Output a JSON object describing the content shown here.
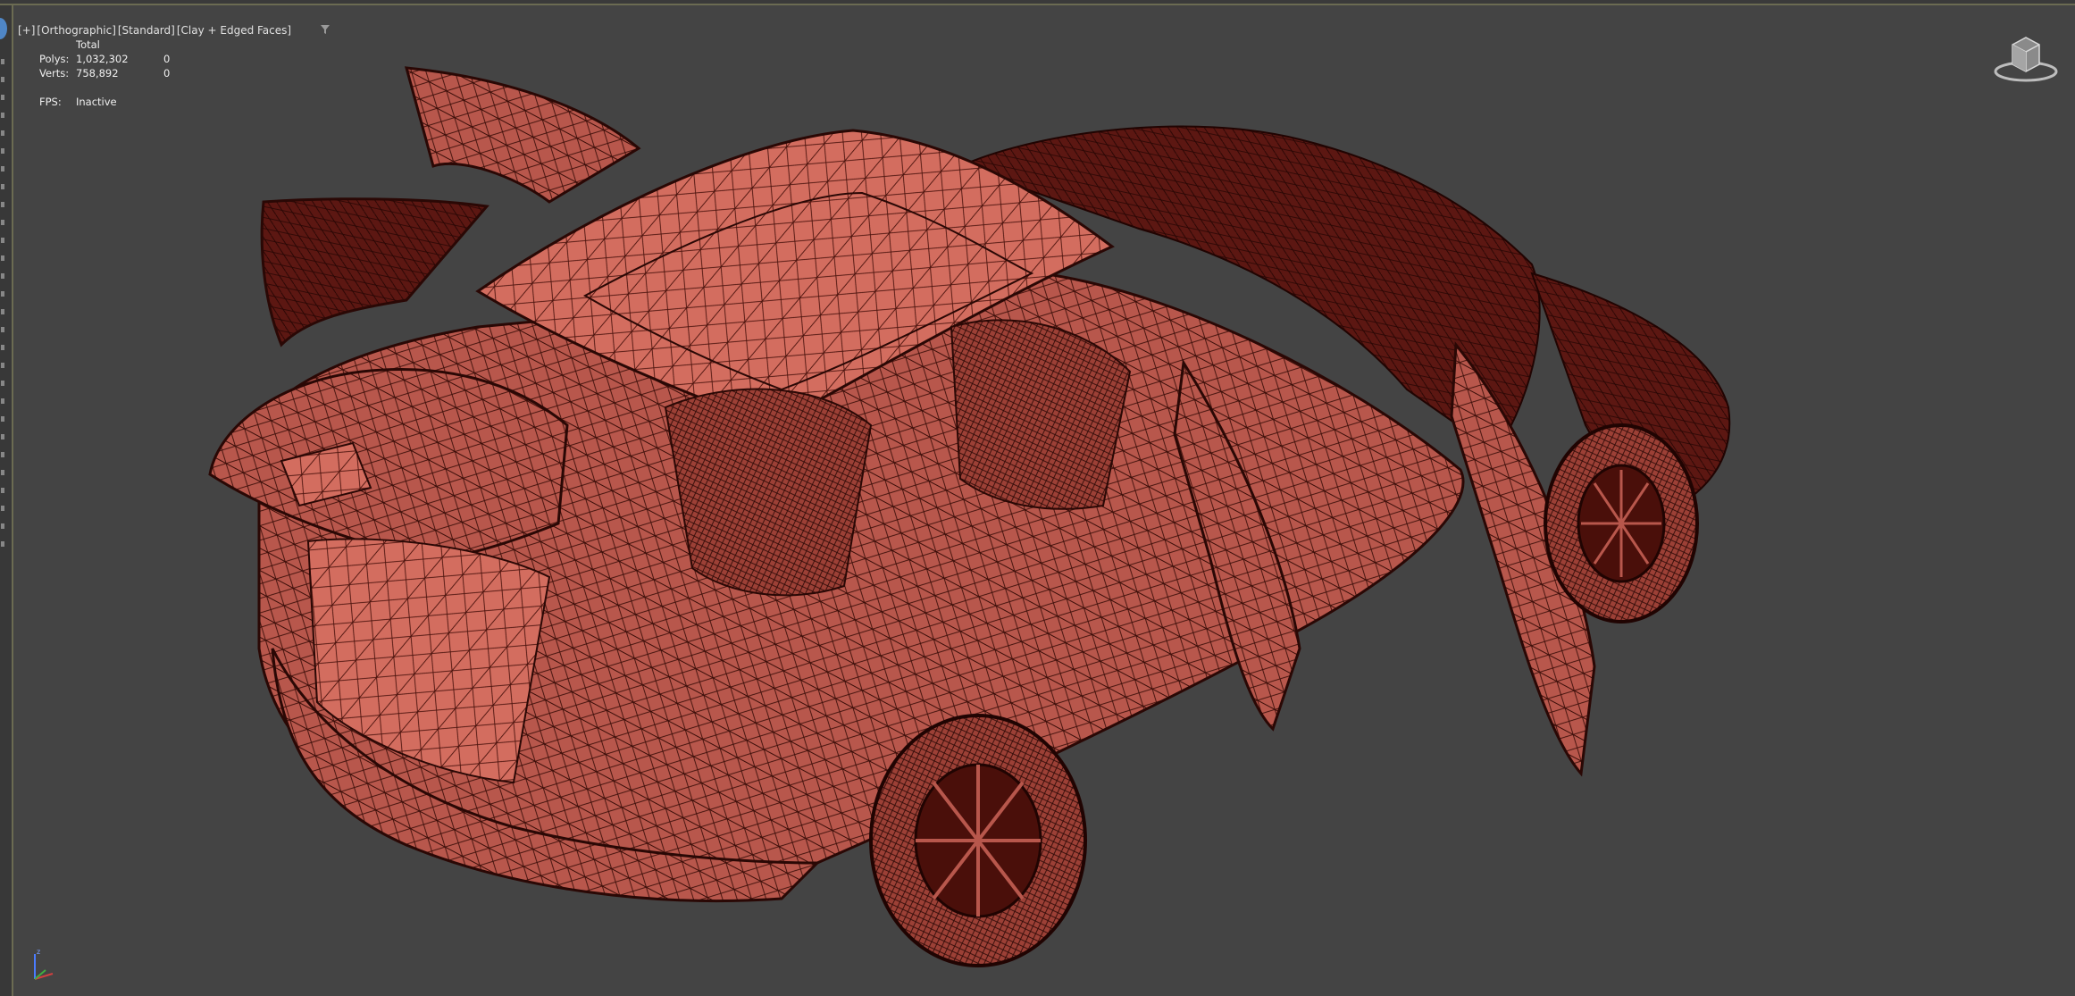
{
  "viewport": {
    "label_parts": [
      "[+]",
      "[Orthographic]",
      "[Standard]",
      "[Clay + Edged Faces]"
    ],
    "filter_icon": "filter-funnel-icon"
  },
  "stats": {
    "header_total": "Total",
    "polys_label": "Polys:",
    "polys_total": "1,032,302",
    "polys_selected": "0",
    "verts_label": "Verts:",
    "verts_total": "758,892",
    "verts_selected": "0",
    "fps_label": "FPS:",
    "fps_value": "Inactive"
  },
  "colors": {
    "viewport_bg": "#444444",
    "mesh_fill": "#b8574c",
    "mesh_edge": "#2a0805",
    "accent_border": "#6b6b52"
  },
  "icons": {
    "viewcube": "viewcube-icon",
    "axis_tripod": "axis-tripod-icon"
  }
}
